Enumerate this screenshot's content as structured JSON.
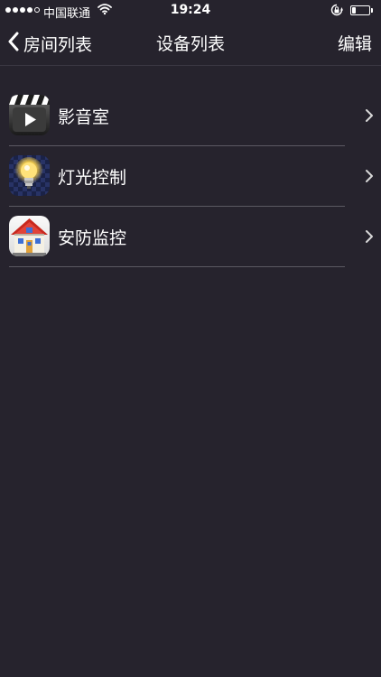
{
  "status_bar": {
    "carrier": "中国联通",
    "time": "19:24",
    "battery_level": 0.2
  },
  "nav": {
    "back_label": "房间列表",
    "title": "设备列表",
    "edit_label": "编辑"
  },
  "devices": [
    {
      "label": "影音室",
      "icon": "clapperboard-play-icon"
    },
    {
      "label": "灯光控制",
      "icon": "light-bulb-icon"
    },
    {
      "label": "安防监控",
      "icon": "house-icon"
    }
  ]
}
